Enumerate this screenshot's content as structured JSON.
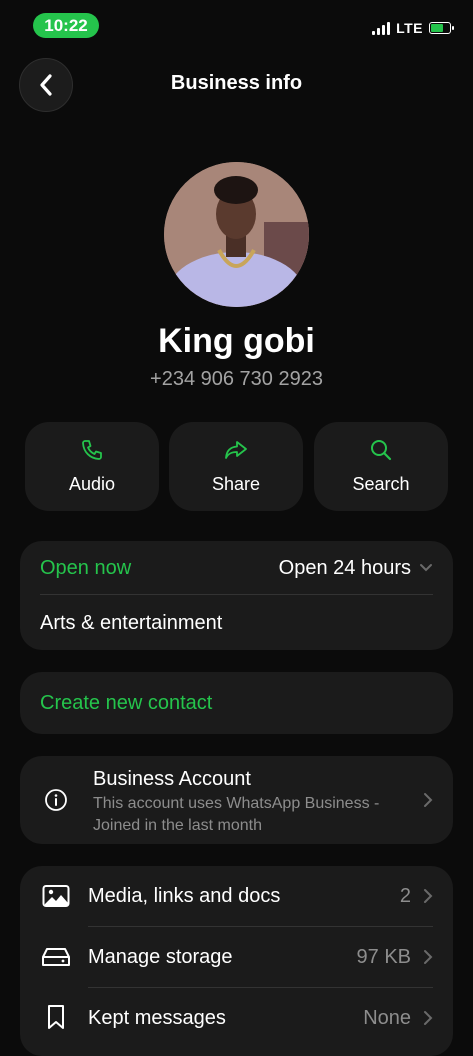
{
  "status_bar": {
    "time": "10:22",
    "network": "LTE"
  },
  "header": {
    "title": "Business info"
  },
  "profile": {
    "name": "King gobi",
    "phone": "+234 906 730 2923"
  },
  "actions": [
    {
      "label": "Audio",
      "icon": "phone-icon"
    },
    {
      "label": "Share",
      "icon": "share-icon"
    },
    {
      "label": "Search",
      "icon": "search-icon"
    }
  ],
  "hours_card": {
    "status": "Open now",
    "hours": "Open 24 hours",
    "category": "Arts & entertainment"
  },
  "create_contact": {
    "label": "Create new contact"
  },
  "business_account": {
    "title": "Business Account",
    "description": "This account uses WhatsApp Business - Joined in the last month"
  },
  "settings_list": [
    {
      "label": "Media, links and docs",
      "value": "2",
      "icon": "image-icon"
    },
    {
      "label": "Manage storage",
      "value": "97 KB",
      "icon": "storage-icon"
    },
    {
      "label": "Kept messages",
      "value": "None",
      "icon": "bookmark-icon"
    }
  ],
  "colors": {
    "accent": "#25c44c",
    "background": "#0b0b0b",
    "card": "#1b1b1b"
  }
}
